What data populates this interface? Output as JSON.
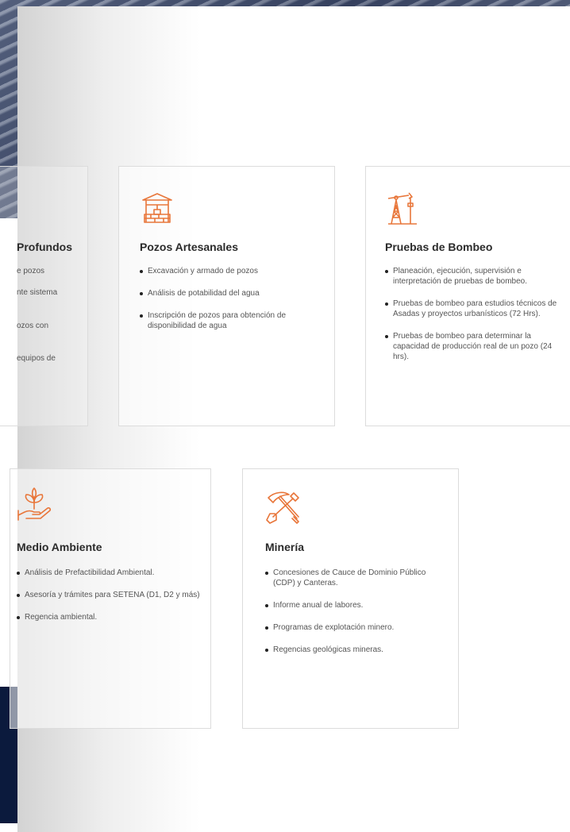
{
  "cards": {
    "profundos": {
      "title_fragment": "Profundos",
      "fragments": [
        "e pozos",
        "nte sistema",
        "ozos con",
        "equipos de"
      ]
    },
    "artesanales": {
      "icon": "well-icon",
      "title": "Pozos Artesanales",
      "items": [
        "Excavación y armado de pozos",
        "Análisis de potabilidad del agua",
        "Inscripción de pozos para obtención de disponibilidad de agua"
      ]
    },
    "bombeo": {
      "icon": "pump-jack-icon",
      "title": "Pruebas de Bombeo",
      "items": [
        "Planeación, ejecución, supervisión e interpretación de pruebas de bombeo.",
        "Pruebas de bombeo para estudios técnicos de Asadas y proyectos urbanísticos (72 Hrs).",
        "Pruebas de bombeo para determinar la capacidad de producción real de un pozo (24 hrs)."
      ]
    },
    "ambiente": {
      "icon": "plant-hand-icon",
      "title": "Medio Ambiente",
      "items": [
        "Análisis de Prefactibilidad Ambiental.",
        "Asesoría y trámites para SETENA (D1, D2 y más)",
        "Regencia ambiental."
      ]
    },
    "mineria": {
      "icon": "pickaxe-shovel-icon",
      "title": "Minería",
      "items": [
        "Concesiones de Cauce de Dominio Público (CDP) y Canteras.",
        "Informe anual de labores.",
        "Programas de explotación minero.",
        "Regencias geológicas mineras."
      ]
    }
  },
  "colors": {
    "accent": "#e8763a",
    "navy": "#0b1a3d"
  }
}
